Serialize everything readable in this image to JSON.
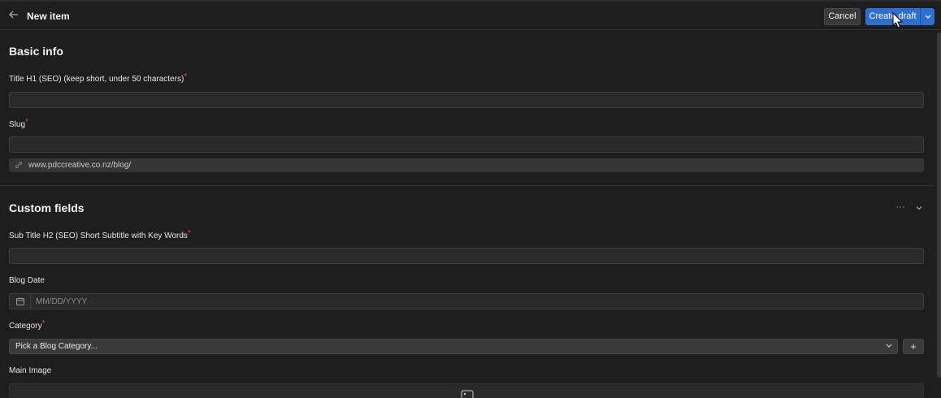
{
  "header": {
    "title": "New item",
    "cancel_label": "Cancel",
    "create_label": "Create draft"
  },
  "basic_info": {
    "title": "Basic info",
    "title_field_label": "Title H1 (SEO) (keep short, under 50 characters)",
    "title_field_value": "",
    "slug_label": "Slug",
    "slug_value": "",
    "slug_prefix": "www.pdccreative.co.nz/blog/"
  },
  "custom_fields": {
    "title": "Custom fields",
    "more_label": "···",
    "subtitle_label": "Sub Title H2 (SEO) Short Subtitle with Key Words",
    "subtitle_value": "",
    "blog_date_label": "Blog Date",
    "blog_date_placeholder": "MM/DD/YYYY",
    "category_label": "Category",
    "category_value": "Pick a Blog Category...",
    "add_label": "+",
    "main_image_label": "Main Image"
  },
  "required_mark": "*",
  "colors": {
    "background": "#1e1e1e",
    "accent": "#2f6fd1",
    "required": "#e5484d"
  }
}
